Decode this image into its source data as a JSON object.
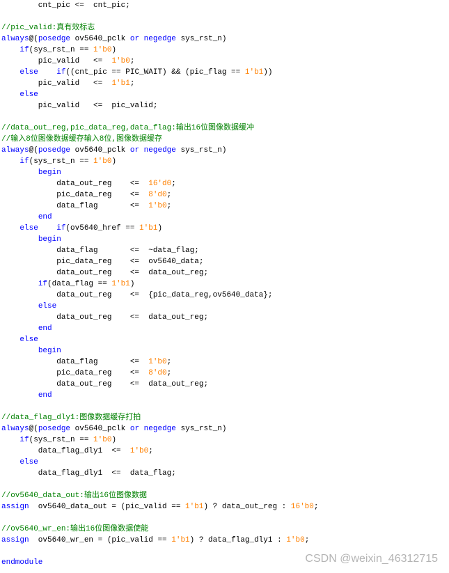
{
  "colors": {
    "keyword": "#0000ff",
    "comment": "#008000",
    "number": "#ff8000",
    "text": "#000000",
    "watermark": "#b4b4b4"
  },
  "watermark": "CSDN @weixin_46312715",
  "lines": [
    [
      [
        "p",
        "        cnt_pic <=  cnt_pic;"
      ]
    ],
    [],
    [
      [
        "c",
        "//pic_valid:真有效标志"
      ]
    ],
    [
      [
        "k",
        "always"
      ],
      [
        "p",
        "@("
      ],
      [
        "k",
        "posedge"
      ],
      [
        "p",
        " ov5640_pclk "
      ],
      [
        "k",
        "or"
      ],
      [
        "p",
        " "
      ],
      [
        "k",
        "negedge"
      ],
      [
        "p",
        " sys_rst_n)"
      ]
    ],
    [
      [
        "p",
        "    "
      ],
      [
        "k",
        "if"
      ],
      [
        "p",
        "(sys_rst_n == "
      ],
      [
        "n",
        "1'b0"
      ],
      [
        "p",
        ")"
      ]
    ],
    [
      [
        "p",
        "        pic_valid   <=  "
      ],
      [
        "n",
        "1'b0"
      ],
      [
        "p",
        ";"
      ]
    ],
    [
      [
        "p",
        "    "
      ],
      [
        "k",
        "else"
      ],
      [
        "p",
        "    "
      ],
      [
        "k",
        "if"
      ],
      [
        "p",
        "((cnt_pic == PIC_WAIT) && (pic_flag == "
      ],
      [
        "n",
        "1'b1"
      ],
      [
        "p",
        "))"
      ]
    ],
    [
      [
        "p",
        "        pic_valid   <=  "
      ],
      [
        "n",
        "1'b1"
      ],
      [
        "p",
        ";"
      ]
    ],
    [
      [
        "p",
        "    "
      ],
      [
        "k",
        "else"
      ]
    ],
    [
      [
        "p",
        "        pic_valid   <=  pic_valid;"
      ]
    ],
    [],
    [
      [
        "c",
        "//data_out_reg,pic_data_reg,data_flag:输出16位图像数据缓冲"
      ]
    ],
    [
      [
        "c",
        "//输入8位图像数据缓存输入8位,图像数据缓存"
      ]
    ],
    [
      [
        "k",
        "always"
      ],
      [
        "p",
        "@("
      ],
      [
        "k",
        "posedge"
      ],
      [
        "p",
        " ov5640_pclk "
      ],
      [
        "k",
        "or"
      ],
      [
        "p",
        " "
      ],
      [
        "k",
        "negedge"
      ],
      [
        "p",
        " sys_rst_n)"
      ]
    ],
    [
      [
        "p",
        "    "
      ],
      [
        "k",
        "if"
      ],
      [
        "p",
        "(sys_rst_n == "
      ],
      [
        "n",
        "1'b0"
      ],
      [
        "p",
        ")"
      ]
    ],
    [
      [
        "p",
        "        "
      ],
      [
        "k",
        "begin"
      ]
    ],
    [
      [
        "p",
        "            data_out_reg    <=  "
      ],
      [
        "n",
        "16'd0"
      ],
      [
        "p",
        ";"
      ]
    ],
    [
      [
        "p",
        "            pic_data_reg    <=  "
      ],
      [
        "n",
        "8'd0"
      ],
      [
        "p",
        ";"
      ]
    ],
    [
      [
        "p",
        "            data_flag       <=  "
      ],
      [
        "n",
        "1'b0"
      ],
      [
        "p",
        ";"
      ]
    ],
    [
      [
        "p",
        "        "
      ],
      [
        "k",
        "end"
      ]
    ],
    [
      [
        "p",
        "    "
      ],
      [
        "k",
        "else"
      ],
      [
        "p",
        "    "
      ],
      [
        "k",
        "if"
      ],
      [
        "p",
        "(ov5640_href == "
      ],
      [
        "n",
        "1'b1"
      ],
      [
        "p",
        ")"
      ]
    ],
    [
      [
        "p",
        "        "
      ],
      [
        "k",
        "begin"
      ]
    ],
    [
      [
        "p",
        "            data_flag       <=  ~data_flag;"
      ]
    ],
    [
      [
        "p",
        "            pic_data_reg    <=  ov5640_data;"
      ]
    ],
    [
      [
        "p",
        "            data_out_reg    <=  data_out_reg;"
      ]
    ],
    [
      [
        "p",
        "        "
      ],
      [
        "k",
        "if"
      ],
      [
        "p",
        "(data_flag == "
      ],
      [
        "n",
        "1'b1"
      ],
      [
        "p",
        ")"
      ]
    ],
    [
      [
        "p",
        "            data_out_reg    <=  {pic_data_reg,ov5640_data};"
      ]
    ],
    [
      [
        "p",
        "        "
      ],
      [
        "k",
        "else"
      ]
    ],
    [
      [
        "p",
        "            data_out_reg    <=  data_out_reg;"
      ]
    ],
    [
      [
        "p",
        "        "
      ],
      [
        "k",
        "end"
      ]
    ],
    [
      [
        "p",
        "    "
      ],
      [
        "k",
        "else"
      ]
    ],
    [
      [
        "p",
        "        "
      ],
      [
        "k",
        "begin"
      ]
    ],
    [
      [
        "p",
        "            data_flag       <=  "
      ],
      [
        "n",
        "1'b0"
      ],
      [
        "p",
        ";"
      ]
    ],
    [
      [
        "p",
        "            pic_data_reg    <=  "
      ],
      [
        "n",
        "8'd0"
      ],
      [
        "p",
        ";"
      ]
    ],
    [
      [
        "p",
        "            data_out_reg    <=  data_out_reg;"
      ]
    ],
    [
      [
        "p",
        "        "
      ],
      [
        "k",
        "end"
      ]
    ],
    [],
    [
      [
        "c",
        "//data_flag_dly1:图像数据缓存打拍"
      ]
    ],
    [
      [
        "k",
        "always"
      ],
      [
        "p",
        "@("
      ],
      [
        "k",
        "posedge"
      ],
      [
        "p",
        " ov5640_pclk "
      ],
      [
        "k",
        "or"
      ],
      [
        "p",
        " "
      ],
      [
        "k",
        "negedge"
      ],
      [
        "p",
        " sys_rst_n)"
      ]
    ],
    [
      [
        "p",
        "    "
      ],
      [
        "k",
        "if"
      ],
      [
        "p",
        "(sys_rst_n == "
      ],
      [
        "n",
        "1'b0"
      ],
      [
        "p",
        ")"
      ]
    ],
    [
      [
        "p",
        "        data_flag_dly1  <=  "
      ],
      [
        "n",
        "1'b0"
      ],
      [
        "p",
        ";"
      ]
    ],
    [
      [
        "p",
        "    "
      ],
      [
        "k",
        "else"
      ]
    ],
    [
      [
        "p",
        "        data_flag_dly1  <=  data_flag;"
      ]
    ],
    [],
    [
      [
        "c",
        "//ov5640_data_out:输出16位图像数据"
      ]
    ],
    [
      [
        "k",
        "assign"
      ],
      [
        "p",
        "  ov5640_data_out = (pic_valid == "
      ],
      [
        "n",
        "1'b1"
      ],
      [
        "p",
        ") ? data_out_reg : "
      ],
      [
        "n",
        "16'b0"
      ],
      [
        "p",
        ";"
      ]
    ],
    [],
    [
      [
        "c",
        "//ov5640_wr_en:输出16位图像数据使能"
      ]
    ],
    [
      [
        "k",
        "assign"
      ],
      [
        "p",
        "  ov5640_wr_en = (pic_valid == "
      ],
      [
        "n",
        "1'b1"
      ],
      [
        "p",
        ") ? data_flag_dly1 : "
      ],
      [
        "n",
        "1'b0"
      ],
      [
        "p",
        ";"
      ]
    ],
    [],
    [
      [
        "k",
        "endmodule"
      ]
    ]
  ]
}
